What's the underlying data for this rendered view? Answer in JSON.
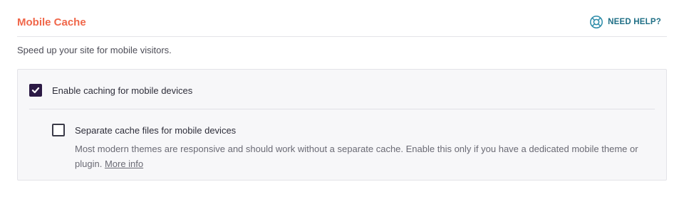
{
  "section": {
    "title": "Mobile Cache",
    "help_label": "NEED HELP?",
    "description": "Speed up your site for mobile visitors."
  },
  "options": {
    "enable_mobile": {
      "label": "Enable caching for mobile devices",
      "checked": true
    },
    "separate_files": {
      "label": "Separate cache files for mobile devices",
      "checked": false,
      "description": "Most modern themes are responsive and should work without a separate cache. Enable this only if you have a dedicated mobile theme or plugin.",
      "more_info_label": "More info"
    }
  },
  "colors": {
    "title": "#f0674a",
    "help": "#1f6f86",
    "checkbox_checked": "#2c1a45"
  },
  "icons": {
    "help": "lifebuoy-icon",
    "check": "checkmark-icon"
  }
}
